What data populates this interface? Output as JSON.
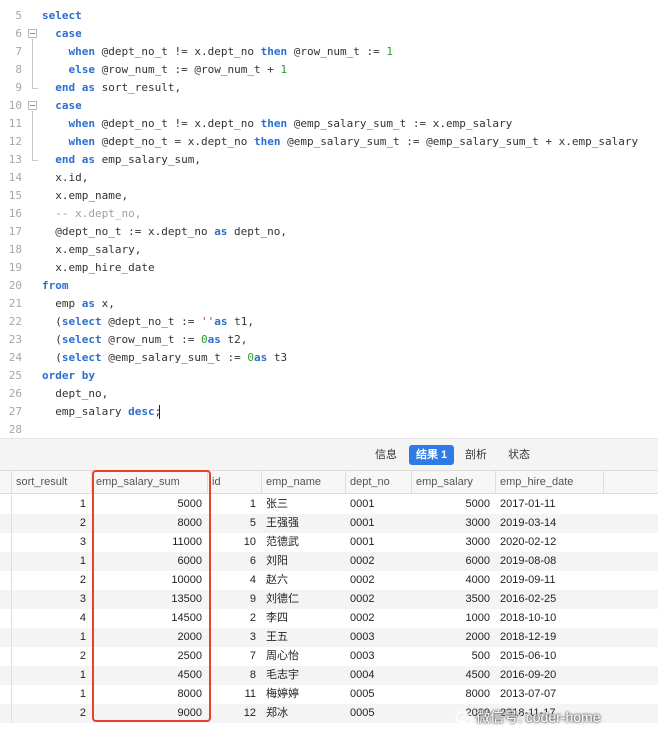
{
  "editor": {
    "lines": [
      {
        "n": "5",
        "tokens": [
          [
            "k",
            "select"
          ]
        ]
      },
      {
        "n": "6",
        "tokens": [
          [
            "",
            "  "
          ],
          [
            "k",
            "case"
          ]
        ]
      },
      {
        "n": "7",
        "tokens": [
          [
            "",
            "    "
          ],
          [
            "k",
            "when"
          ],
          [
            "",
            " @dept_no_t != x.dept_no "
          ],
          [
            "k",
            "then"
          ],
          [
            "",
            " @row_num_t := "
          ],
          [
            "n",
            "1"
          ]
        ]
      },
      {
        "n": "8",
        "tokens": [
          [
            "",
            "    "
          ],
          [
            "k",
            "else"
          ],
          [
            "",
            " @row_num_t := @row_num_t + "
          ],
          [
            "n",
            "1"
          ]
        ]
      },
      {
        "n": "9",
        "tokens": [
          [
            "",
            "  "
          ],
          [
            "k",
            "end"
          ],
          [
            "",
            " "
          ],
          [
            "k",
            "as"
          ],
          [
            "",
            " sort_result,"
          ]
        ]
      },
      {
        "n": "10",
        "tokens": [
          [
            "",
            "  "
          ],
          [
            "k",
            "case"
          ]
        ]
      },
      {
        "n": "11",
        "tokens": [
          [
            "",
            "    "
          ],
          [
            "k",
            "when"
          ],
          [
            "",
            " @dept_no_t != x.dept_no "
          ],
          [
            "k",
            "then"
          ],
          [
            "",
            " @emp_salary_sum_t := x.emp_salary"
          ]
        ]
      },
      {
        "n": "12",
        "tokens": [
          [
            "",
            "    "
          ],
          [
            "k",
            "when"
          ],
          [
            "",
            " @dept_no_t = x.dept_no "
          ],
          [
            "k",
            "then"
          ],
          [
            "",
            " @emp_salary_sum_t := @emp_salary_sum_t + x.emp_salary"
          ]
        ]
      },
      {
        "n": "13",
        "tokens": [
          [
            "",
            "  "
          ],
          [
            "k",
            "end"
          ],
          [
            "",
            " "
          ],
          [
            "k",
            "as"
          ],
          [
            "",
            " emp_salary_sum,"
          ]
        ]
      },
      {
        "n": "14",
        "tokens": [
          [
            "",
            "  x.id,"
          ]
        ]
      },
      {
        "n": "15",
        "tokens": [
          [
            "",
            "  x.emp_name,"
          ]
        ]
      },
      {
        "n": "16",
        "tokens": [
          [
            "",
            "  "
          ],
          [
            "c",
            "-- x.dept_no,"
          ]
        ]
      },
      {
        "n": "17",
        "tokens": [
          [
            "",
            "  @dept_no_t := x.dept_no "
          ],
          [
            "k",
            "as"
          ],
          [
            "",
            " dept_no,"
          ]
        ]
      },
      {
        "n": "18",
        "tokens": [
          [
            "",
            "  x.emp_salary,"
          ]
        ]
      },
      {
        "n": "19",
        "tokens": [
          [
            "",
            "  x.emp_hire_date"
          ]
        ]
      },
      {
        "n": "20",
        "tokens": [
          [
            "k",
            "from"
          ]
        ]
      },
      {
        "n": "21",
        "tokens": [
          [
            "",
            "  emp "
          ],
          [
            "k",
            "as"
          ],
          [
            "",
            " x,"
          ]
        ]
      },
      {
        "n": "22",
        "tokens": [
          [
            "",
            "  ("
          ],
          [
            "k",
            "select"
          ],
          [
            "",
            " @dept_no_t := "
          ],
          [
            "s",
            "''"
          ],
          [
            ") "
          ],
          [
            "k",
            "as"
          ],
          [
            "",
            " t1,"
          ]
        ]
      },
      {
        "n": "23",
        "tokens": [
          [
            "",
            "  ("
          ],
          [
            "k",
            "select"
          ],
          [
            "",
            " @row_num_t := "
          ],
          [
            "n",
            "0"
          ],
          [
            ") "
          ],
          [
            "k",
            "as"
          ],
          [
            "",
            " t2,"
          ]
        ]
      },
      {
        "n": "24",
        "tokens": [
          [
            "",
            "  ("
          ],
          [
            "k",
            "select"
          ],
          [
            "",
            " @emp_salary_sum_t := "
          ],
          [
            "n",
            "0"
          ],
          [
            ") "
          ],
          [
            "k",
            "as"
          ],
          [
            "",
            " t3"
          ]
        ]
      },
      {
        "n": "25",
        "tokens": [
          [
            "k",
            "order by"
          ]
        ]
      },
      {
        "n": "26",
        "tokens": [
          [
            "",
            "  dept_no,"
          ]
        ]
      },
      {
        "n": "27",
        "tokens": [
          [
            "",
            "  emp_salary "
          ],
          [
            "k",
            "desc"
          ],
          [
            "",
            ";"
          ]
        ]
      },
      {
        "n": "28",
        "tokens": []
      }
    ]
  },
  "tabs": [
    {
      "label": "信息",
      "active": false
    },
    {
      "label": "结果 1",
      "active": true
    },
    {
      "label": "剖析",
      "active": false
    },
    {
      "label": "状态",
      "active": false
    }
  ],
  "grid": {
    "columns": [
      "sort_result",
      "emp_salary_sum",
      "id",
      "emp_name",
      "dept_no",
      "emp_salary",
      "emp_hire_date"
    ],
    "rows": [
      [
        "1",
        "5000",
        "1",
        "张三",
        "0001",
        "5000",
        "2017-01-11"
      ],
      [
        "2",
        "8000",
        "5",
        "王强强",
        "0001",
        "3000",
        "2019-03-14"
      ],
      [
        "3",
        "11000",
        "10",
        "范德武",
        "0001",
        "3000",
        "2020-02-12"
      ],
      [
        "1",
        "6000",
        "6",
        "刘阳",
        "0002",
        "6000",
        "2019-08-08"
      ],
      [
        "2",
        "10000",
        "4",
        "赵六",
        "0002",
        "4000",
        "2019-09-11"
      ],
      [
        "3",
        "13500",
        "9",
        "刘德仁",
        "0002",
        "3500",
        "2016-02-25"
      ],
      [
        "4",
        "14500",
        "2",
        "李四",
        "0002",
        "1000",
        "2018-10-10"
      ],
      [
        "1",
        "2000",
        "3",
        "王五",
        "0003",
        "2000",
        "2018-12-19"
      ],
      [
        "2",
        "2500",
        "7",
        "周心怡",
        "0003",
        "500",
        "2015-06-10"
      ],
      [
        "1",
        "4500",
        "8",
        "毛志宇",
        "0004",
        "4500",
        "2016-09-20"
      ],
      [
        "1",
        "8000",
        "11",
        "梅婷婷",
        "0005",
        "8000",
        "2013-07-07"
      ],
      [
        "2",
        "9000",
        "12",
        "郑冰",
        "0005",
        "2000",
        "2018-11-17"
      ]
    ]
  },
  "watermark": {
    "text": "微信号: coder-home"
  },
  "colors": {
    "keyword": "#2b6fd1",
    "number": "#2e9b2e",
    "comment": "#a0a0a0",
    "accent": "#2f7be5",
    "highlight": "#e8412e"
  }
}
